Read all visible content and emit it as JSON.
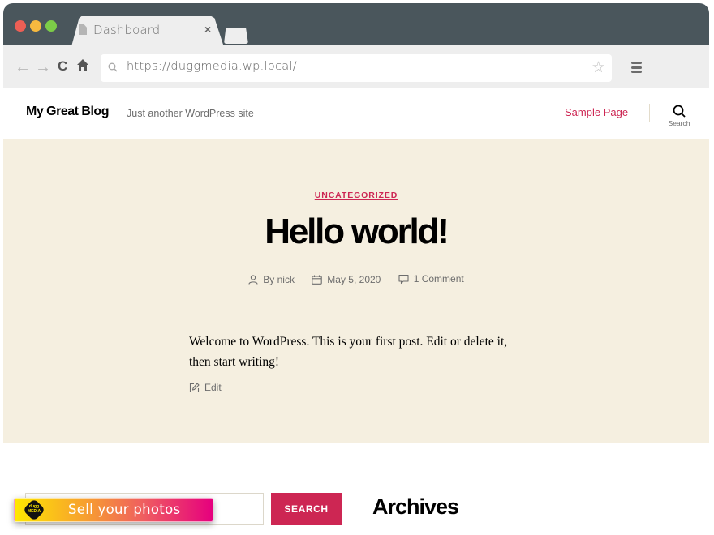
{
  "browser": {
    "tab_title": "Dashboard",
    "tab_close": "×",
    "url": "https://duggmedia.wp.local/",
    "back_icon": "←",
    "forward_icon": "→",
    "reload_icon": "C",
    "star_icon": "☆"
  },
  "site": {
    "title": "My Great Blog",
    "description": "Just another WordPress site",
    "nav": [
      {
        "label": "Sample Page"
      }
    ],
    "search_toggle_label": "Search",
    "accent_color": "#cd2653",
    "hero_background": "#f5efe0"
  },
  "post": {
    "category": "UNCATEGORIZED",
    "title": "Hello world!",
    "author": "By nick",
    "date": "May 5, 2020",
    "comments": "1 Comment",
    "body": "Welcome to WordPress. This is your first post. Edit or delete it, then start writing!",
    "edit_label": "Edit"
  },
  "widgets": {
    "search_placeholder": "",
    "search_button": "SEARCH",
    "archives_title": "Archives"
  },
  "promo": {
    "logo_text": "dugg MEDIA",
    "label": "Sell your photos"
  }
}
